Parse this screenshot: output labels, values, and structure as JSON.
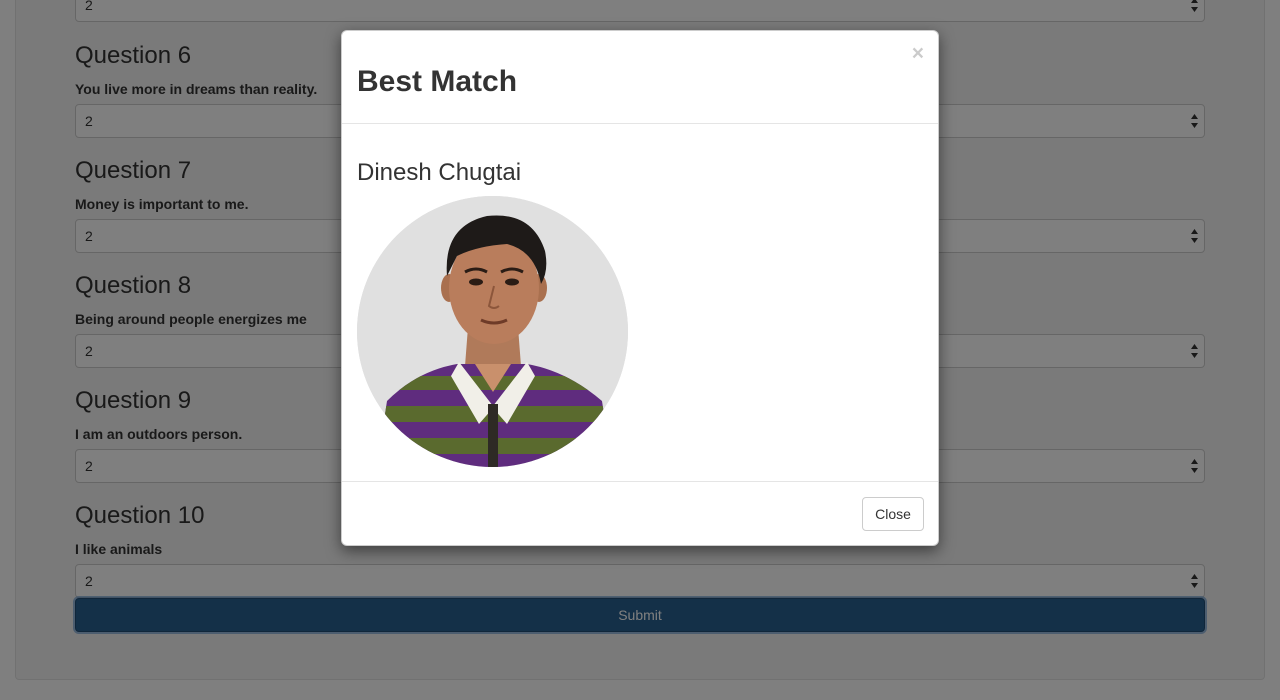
{
  "form": {
    "top_select_value": "2",
    "questions": [
      {
        "title": "Question 6",
        "text": "You live more in dreams than reality.",
        "value": "2"
      },
      {
        "title": "Question 7",
        "text": "Money is important to me.",
        "value": "2"
      },
      {
        "title": "Question 8",
        "text": "Being around people energizes me",
        "value": "2"
      },
      {
        "title": "Question 9",
        "text": "I am an outdoors person.",
        "value": "2"
      },
      {
        "title": "Question 10",
        "text": "I like animals",
        "value": "2"
      }
    ],
    "submit_label": "Submit"
  },
  "modal": {
    "title": "Best Match",
    "close_icon": "×",
    "match_name": "Dinesh Chugtai",
    "close_label": "Close"
  },
  "colors": {
    "primary": "#286090",
    "backdrop": "rgba(0,0,0,0.5)"
  }
}
